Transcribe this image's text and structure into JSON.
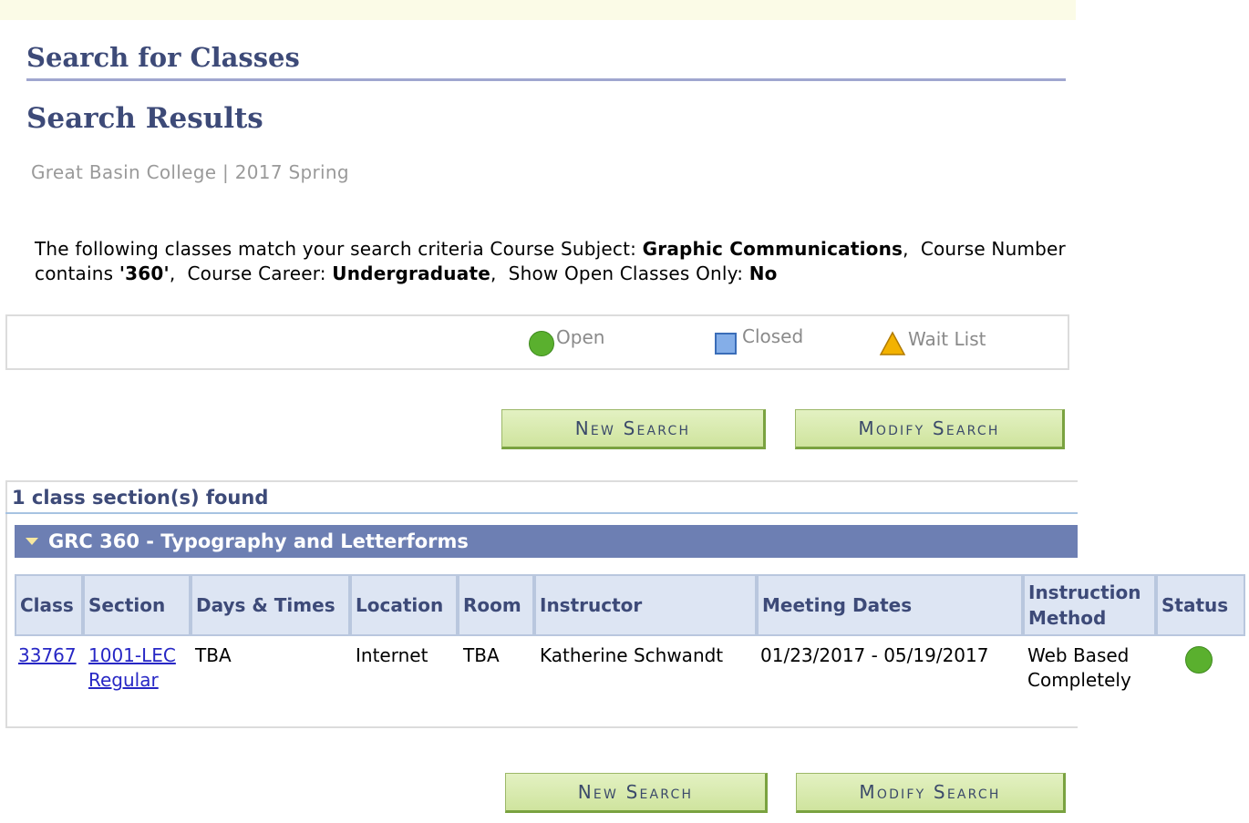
{
  "page": {
    "title": "Search for Classes",
    "subtitle": "Search Results",
    "institution": "Great Basin College",
    "separator": "|",
    "term": "2017 Spring"
  },
  "criteria": {
    "intro": "The following classes match your search criteria Course Subject:",
    "subject": "Graphic Communications",
    "comma": ",",
    "number_label": "Course Number contains",
    "number_value": "'360'",
    "career_label": "Course Career:",
    "career_value": "Undergraduate",
    "open_label": "Show Open Classes Only:",
    "open_value": "No"
  },
  "legend": {
    "open": "Open",
    "closed": "Closed",
    "waitlist": "Wait List"
  },
  "buttons": {
    "new_search": "New Search",
    "modify_search": "Modify Search"
  },
  "results": {
    "count_text": "1 class section(s) found",
    "course_title": "GRC 360 - Typography and Letterforms",
    "headers": {
      "class": "Class",
      "section": "Section",
      "days_times": "Days & Times",
      "location": "Location",
      "room": "Room",
      "instructor": "Instructor",
      "meeting_dates": "Meeting Dates",
      "instruction_method": "Instruction Method",
      "status": "Status"
    },
    "rows": [
      {
        "class": "33767",
        "section_line1": "1001-LEC",
        "section_line2": "Regular",
        "days_times": "TBA",
        "location": "Internet",
        "room": "TBA",
        "instructor": "Katherine Schwandt",
        "meeting_dates": "01/23/2017 - 05/19/2017",
        "instruction_method": "Web Based Completely",
        "status": "open"
      }
    ]
  },
  "colors": {
    "heading": "#3d4a78",
    "course_bar": "#6d7fb3",
    "header_bg": "#dde5f3",
    "button_bg": "#d6e9ac",
    "open_green": "#5ab02e",
    "closed_blue": "#84aee8",
    "waitlist_yellow": "#f3b200"
  }
}
